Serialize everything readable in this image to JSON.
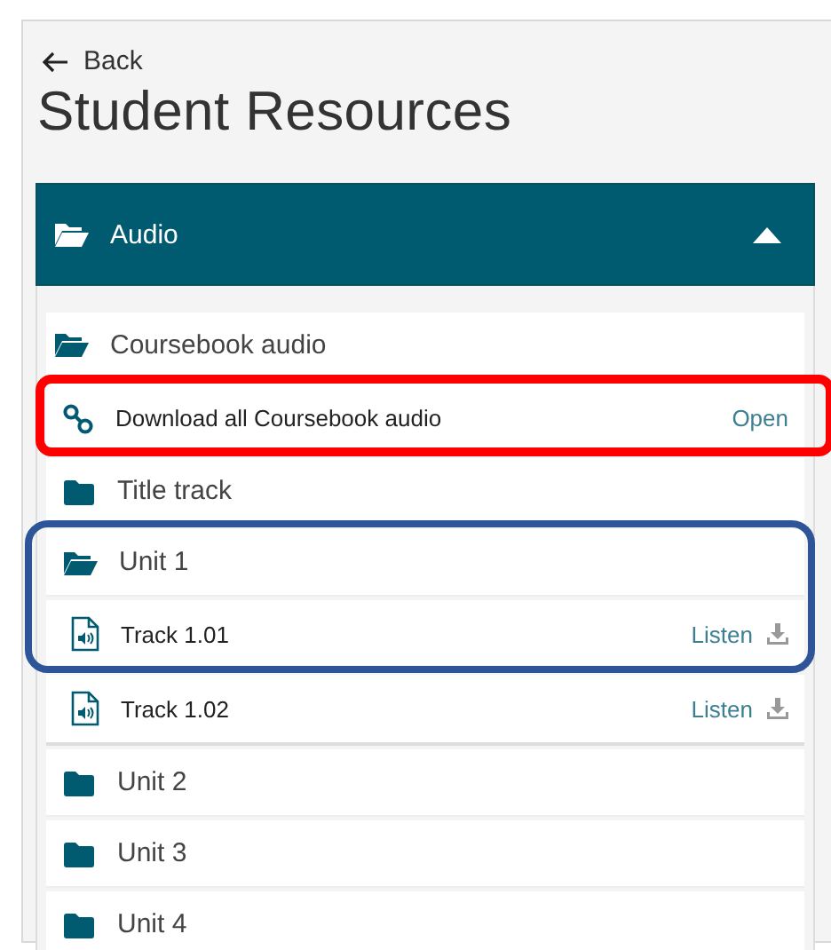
{
  "back": {
    "label": "Back"
  },
  "page_title": "Student Resources",
  "section": {
    "title": "Audio",
    "expanded": true,
    "items": [
      {
        "kind": "folder",
        "label": "Coursebook audio",
        "expanded": true,
        "children": [
          {
            "kind": "link",
            "label": "Download all Coursebook audio",
            "action": "Open",
            "color": "#ff0000"
          },
          {
            "kind": "folder",
            "label": "Title track",
            "expanded": false
          },
          {
            "kind": "folder",
            "label": "Unit 1",
            "expanded": true,
            "color": "#2e5597",
            "children": [
              {
                "kind": "audio",
                "label": "Track 1.01",
                "action": "Listen",
                "color": "#2e5597"
              },
              {
                "kind": "audio",
                "label": "Track 1.02",
                "action": "Listen"
              }
            ]
          },
          {
            "kind": "folder",
            "label": "Unit 2",
            "expanded": false
          },
          {
            "kind": "folder",
            "label": "Unit 3",
            "expanded": false
          },
          {
            "kind": "folder",
            "label": "Unit 4",
            "expanded": false
          }
        ]
      }
    ]
  }
}
